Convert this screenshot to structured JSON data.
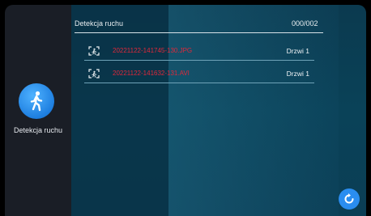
{
  "sidebar": {
    "mode_icon": "walking-person-icon",
    "mode_label": "Detekcja ruchu"
  },
  "header": {
    "title": "Detekcja ruchu",
    "count": "000/002"
  },
  "files": [
    {
      "icon": "motion-capture-icon",
      "name": "20221122-141745-130.JPG",
      "source": "Drzwi 1"
    },
    {
      "icon": "motion-capture-icon",
      "name": "20221122-141632-131.AVI",
      "source": "Drzwi 1"
    }
  ],
  "footer": {
    "refresh_icon": "refresh-icon"
  },
  "colors": {
    "filename": "#e0283a",
    "accent": "#2a8df0",
    "panel": "#0b3a4f"
  }
}
